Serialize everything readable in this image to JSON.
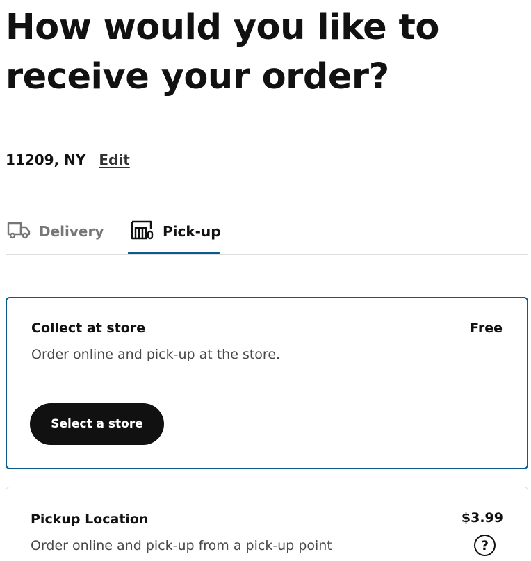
{
  "heading": "How would you like to receive your order?",
  "location": {
    "text": "11209, NY",
    "edit_label": "Edit"
  },
  "tabs": [
    {
      "label": "Delivery",
      "icon": "truck-icon",
      "selected": false
    },
    {
      "label": "Pick-up",
      "icon": "store-icon",
      "selected": true
    }
  ],
  "options": [
    {
      "title": "Collect at store",
      "description": "Order online and pick-up at the store.",
      "price": "Free",
      "button_label": "Select a store",
      "selected": true
    },
    {
      "title": "Pickup Location",
      "description": "Order online and pick-up from a pick-up point",
      "price": "$3.99",
      "help_icon": "question-circle-icon",
      "help_glyph": "?",
      "selected": false
    }
  ],
  "colors": {
    "accent": "#0a5a8e",
    "text": "#111111",
    "muted": "#767676",
    "button_bg": "#111111"
  }
}
